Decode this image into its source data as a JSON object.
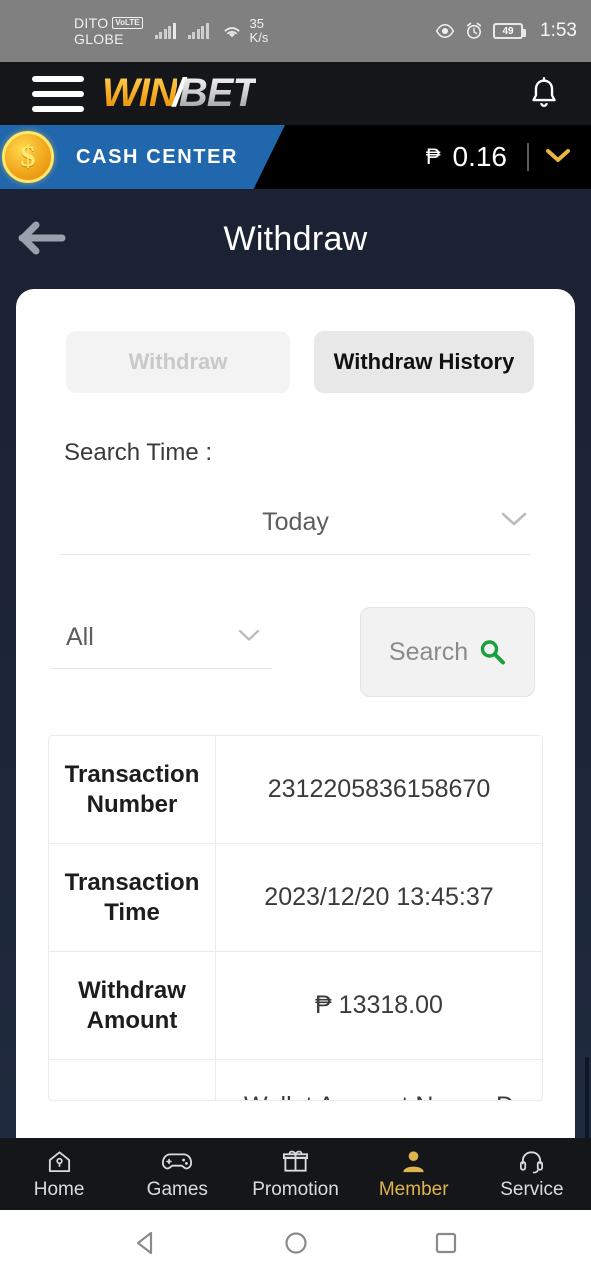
{
  "status_bar": {
    "carrier_primary": "DITO",
    "volte_badge": "VoLTE",
    "carrier_secondary": "GLOBE",
    "net_speed_value": "35",
    "net_speed_unit": "K/s",
    "battery_level": "49",
    "clock": "1:53",
    "icons": [
      "signal-bars-icon",
      "signal-bars-icon",
      "wifi-icon",
      "eye-icon",
      "alarm-icon",
      "battery-icon"
    ]
  },
  "app_header": {
    "menu_icon": "hamburger-menu-icon",
    "logo_part_1": "WIN",
    "logo_slash": "/",
    "logo_part_2": "BET",
    "notification_icon": "bell-icon"
  },
  "cash_bar": {
    "coin_symbol": "$",
    "label": "CASH CENTER",
    "currency_symbol": "₱",
    "balance": "0.16",
    "expand_icon": "chevron-down-icon",
    "accent_blue": "#2167ad",
    "accent_gold": "#f0a31a"
  },
  "page": {
    "back_icon": "back-arrow-icon",
    "title": "Withdraw"
  },
  "tabs": [
    {
      "label": "Withdraw",
      "active": false
    },
    {
      "label": "Withdraw History",
      "active": true
    }
  ],
  "filters": {
    "search_time_label": "Search Time :",
    "time_range_value": "Today",
    "time_range_icon": "chevron-down-icon",
    "type_value": "All",
    "type_icon": "chevron-down-icon",
    "search_button_label": "Search",
    "search_button_icon": "search-icon",
    "search_icon_color": "#19a03a"
  },
  "transaction_table": {
    "rows": [
      {
        "label": "Transaction Number",
        "value": "2312205836158670",
        "clipped": false
      },
      {
        "label": "Transaction Time",
        "value": "2023/12/20 13:45:37",
        "clipped": false
      },
      {
        "label": "Withdraw Amount",
        "value": "₱ 13318.00",
        "clipped": false
      },
      {
        "label": "",
        "value": "Wallet Account Name: D",
        "clipped": true
      }
    ]
  },
  "bottom_nav": [
    {
      "label": "Home",
      "icon": "home-icon",
      "active": false
    },
    {
      "label": "Games",
      "icon": "gamepad-icon",
      "active": false
    },
    {
      "label": "Promotion",
      "icon": "gift-icon",
      "active": false
    },
    {
      "label": "Member",
      "icon": "user-icon",
      "active": true
    },
    {
      "label": "Service",
      "icon": "headset-icon",
      "active": false
    }
  ],
  "system_nav": {
    "back": "back-triangle-icon",
    "home": "home-circle-icon",
    "recents": "recents-square-icon"
  }
}
